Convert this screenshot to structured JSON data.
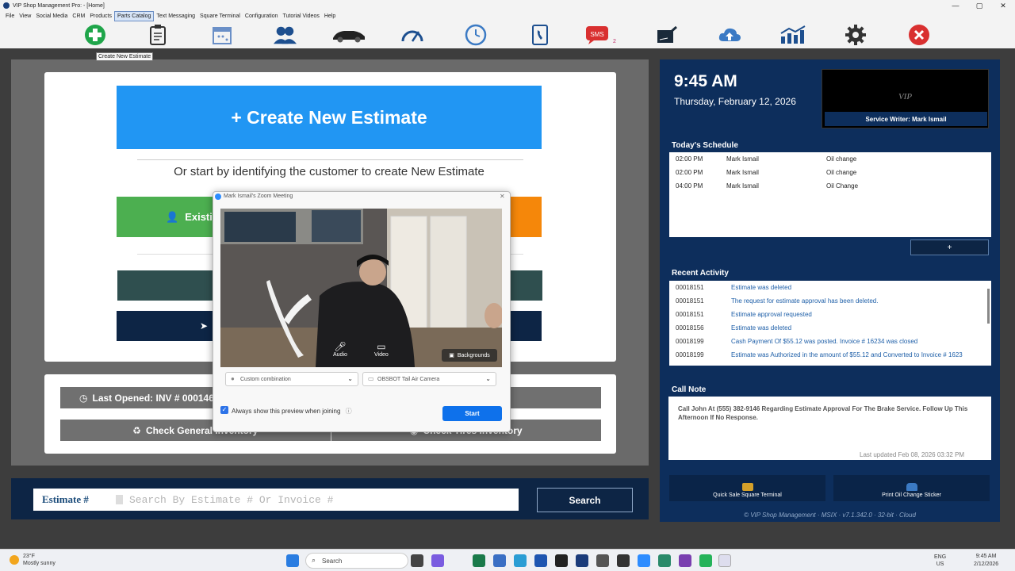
{
  "window": {
    "title": "VIP Shop Management Pro: - [Home]",
    "controls": [
      "—",
      "▢",
      "✕"
    ]
  },
  "menu": [
    "File",
    "View",
    "Social Media",
    "CRM",
    "Products",
    "Parts Catalog",
    "Text Messaging",
    "Square Terminal",
    "Configuration",
    "Tutorial Videos",
    "Help"
  ],
  "toolbar": {
    "tooltip": "Create New Estimate",
    "sms_label": "SMS",
    "sms_badge": "2"
  },
  "estimate": {
    "create_label": "+ Create New Estimate",
    "subtitle": "Or start by identifying the customer to create New Estimate",
    "existing_label": "Existin",
    "last_opened": "Last Opened: INV # 00014690 -",
    "check_general": "Check General Inventory",
    "check_tires": "Check Tires Inventory"
  },
  "search": {
    "label": "Estimate #",
    "placeholder": "Search By Estimate # Or Invoice #",
    "button": "Search"
  },
  "clock": {
    "time": "9:45 AM",
    "date": "Thursday, February 12, 2026"
  },
  "vip": {
    "logo": "VIP",
    "writer": "Service Writer: Mark Ismail"
  },
  "schedule": {
    "title": "Today's Schedule",
    "rows": [
      {
        "time": "02:00 PM",
        "name": "Mark Ismail",
        "service": "Oil change"
      },
      {
        "time": "02:00 PM",
        "name": "Mark Ismail",
        "service": "Oil change"
      },
      {
        "time": "04:00 PM",
        "name": "Mark Ismail",
        "service": "Oil Change"
      }
    ],
    "add": "+"
  },
  "activity": {
    "title": "Recent Activity",
    "rows": [
      {
        "id": "00018151",
        "text": "Estimate was deleted"
      },
      {
        "id": "00018151",
        "text": "The request for estimate approval has been deleted."
      },
      {
        "id": "00018151",
        "text": "Estimate approval requested"
      },
      {
        "id": "00018156",
        "text": "Estimate was deleted"
      },
      {
        "id": "00018199",
        "text": "Cash Payment Of $55.12 was posted. Invoice # 16234 was closed"
      },
      {
        "id": "00018199",
        "text": "Estimate was Authorized in the amount of $55.12 and Converted to Invoice # 1623"
      }
    ]
  },
  "call_note": {
    "title": "Call Note",
    "text": "Call John At (555) 382-9146 Regarding Estimate Approval For The Brake Service. Follow Up This Afternoon If No Response.",
    "updated": "Last updated Feb 08, 2026  03:32 PM"
  },
  "quick": {
    "square": "Quick Sale Square Terminal",
    "sticker": "Print Oil Change Sticker"
  },
  "footer": "© VIP Shop Management · MSIX · v7.1.342.0 · 32-bit · Cloud",
  "zoom": {
    "title": "Mark Ismail's Zoom Meeting",
    "audio": "Audio",
    "video": "Video",
    "backgrounds": "Backgrounds",
    "mic_select": "Custom combination",
    "cam_select": "OBSBOT Tail Air Camera",
    "always_show": "Always show this preview when joining",
    "start": "Start"
  },
  "taskbar": {
    "temp": "23°F",
    "weather": "Mostly sunny",
    "search": "Search",
    "lang1": "ENG",
    "lang2": "US",
    "time": "9:45 AM",
    "date": "2/12/2026"
  },
  "colors": {
    "primary_blue": "#2196f3",
    "green": "#4caf50",
    "orange": "#f5870a",
    "navy": "#0d2e5c",
    "zoom_blue": "#0e71eb"
  }
}
